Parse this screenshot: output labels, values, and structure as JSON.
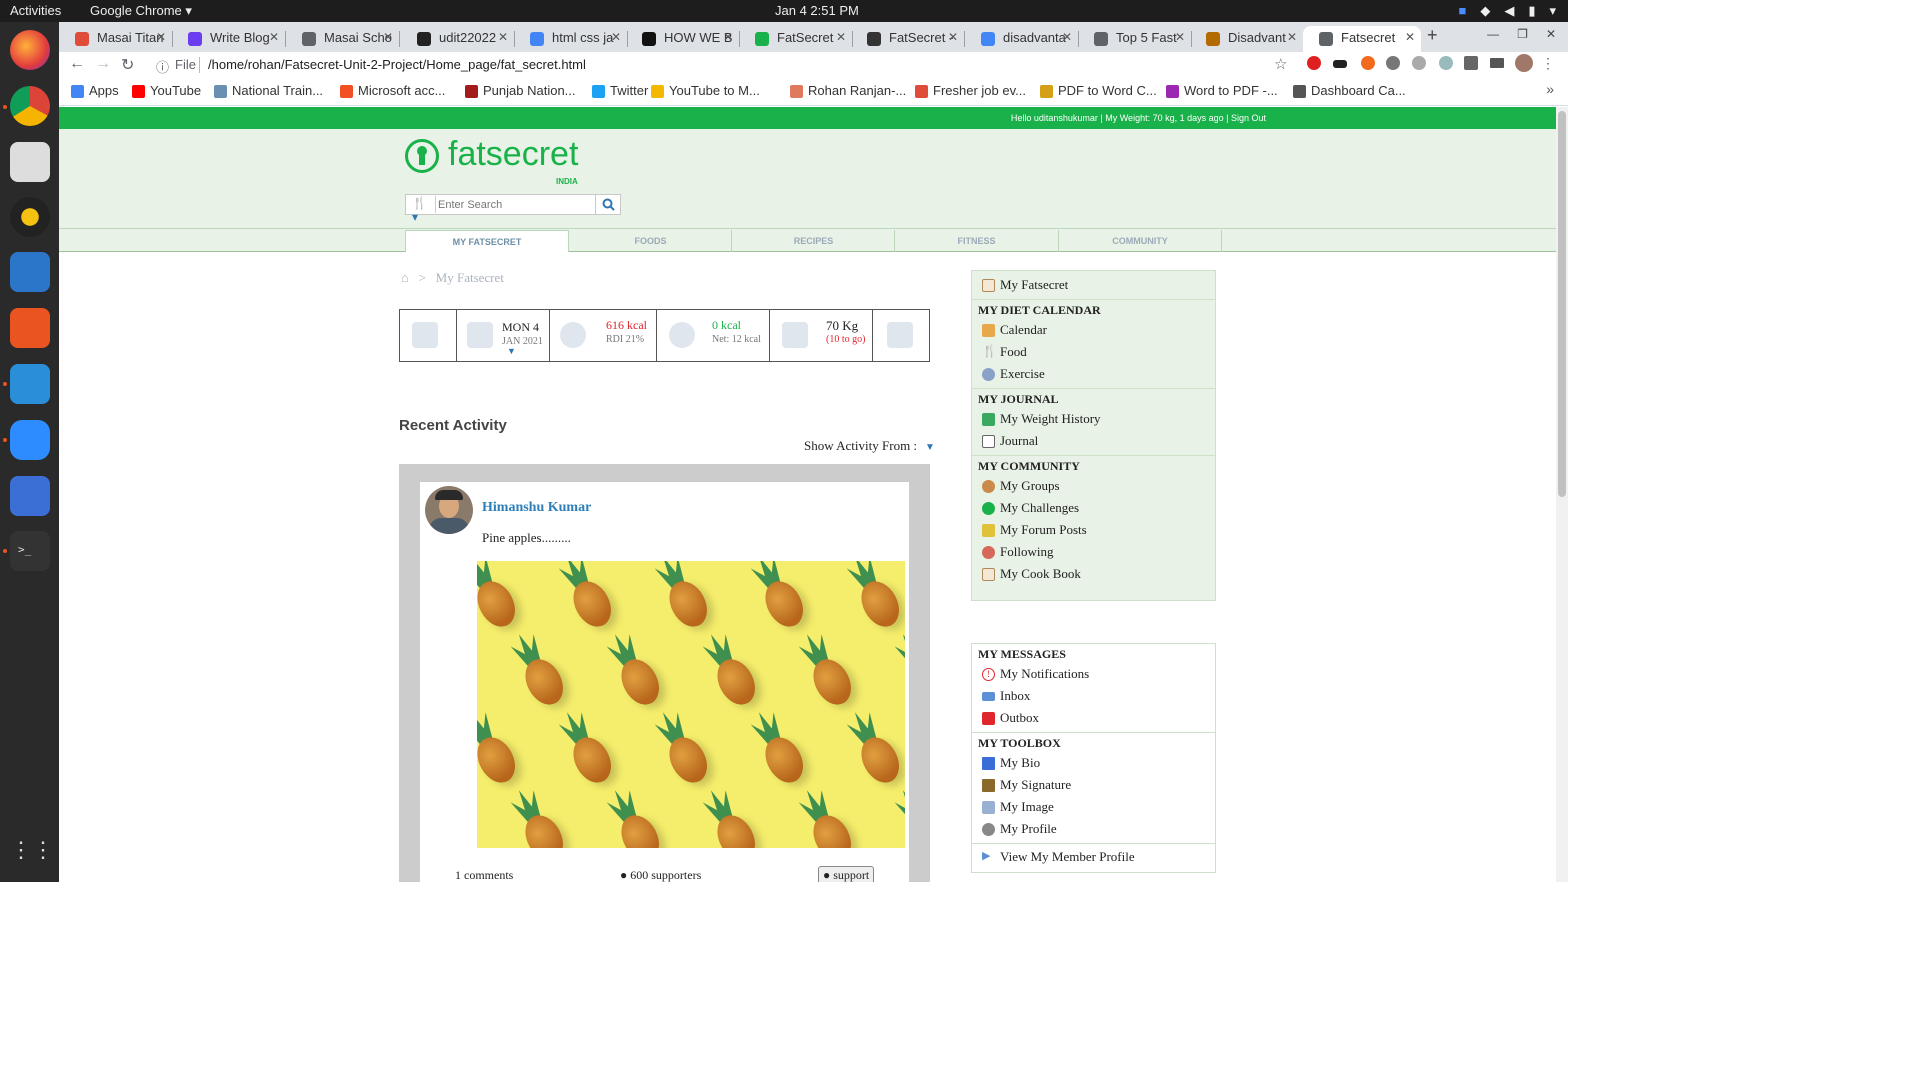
{
  "os": {
    "activities": "Activities",
    "app_name": "Google Chrome",
    "clock": "Jan 4   2:51 PM"
  },
  "browser": {
    "tabs": [
      {
        "label": "Masai Titan",
        "color": "#e04c3a"
      },
      {
        "label": "Write Blog",
        "color": "#6a3df0"
      },
      {
        "label": "Masai Scho",
        "color": "#5f6368"
      },
      {
        "label": "udit22022",
        "color": "#222222"
      },
      {
        "label": "html css ja",
        "color": "#4285f4"
      },
      {
        "label": "HOW WE B",
        "color": "#111111"
      },
      {
        "label": "FatSecret",
        "color": "#19b24a"
      },
      {
        "label": "FatSecret -",
        "color": "#333333"
      },
      {
        "label": "disadvanta",
        "color": "#4285f4"
      },
      {
        "label": "Top 5 Fast",
        "color": "#5f6368"
      },
      {
        "label": "Disadvant",
        "color": "#b36b00"
      },
      {
        "label": "Fatsecret",
        "color": "#5f6368"
      }
    ],
    "active_tab_index": 11,
    "new_tab": "+",
    "address_prefix": "File",
    "url": "/home/rohan/Fatsecret-Unit-2-Project/Home_page/fat_secret.html",
    "bookmarks": [
      {
        "label": "Apps",
        "color": "#4285f4"
      },
      {
        "label": "YouTube",
        "color": "#ff0000"
      },
      {
        "label": "National Train...",
        "color": "#6b8fb3"
      },
      {
        "label": "Microsoft acc...",
        "color": "#f25022"
      },
      {
        "label": "Punjab Nation...",
        "color": "#a31c1c"
      },
      {
        "label": "Twitter",
        "color": "#1da1f2"
      },
      {
        "label": "YouTube to M...",
        "color": "#f5b800"
      },
      {
        "label": "Rohan Ranjan-...",
        "color": "#e07a5f"
      },
      {
        "label": "Fresher job ev...",
        "color": "#e04c3a"
      },
      {
        "label": "PDF to Word C...",
        "color": "#d4a017"
      },
      {
        "label": "Word to PDF -...",
        "color": "#9c27b0"
      },
      {
        "label": "Dashboard Ca...",
        "color": "#555555"
      }
    ],
    "bookmarks_more": "»"
  },
  "site": {
    "greeting": "Hello uditanshukumar | My Weight: 70 kg, 1 days ago | Sign Out",
    "logo_word": "fatsecret",
    "logo_country": "INDIA",
    "search_placeholder": "Enter Search",
    "nav": [
      "MY FATSECRET",
      "FOODS",
      "RECIPES",
      "FITNESS",
      "COMMUNITY"
    ],
    "breadcrumb_sep": ">",
    "breadcrumb": "My Fatsecret",
    "summary": {
      "day": "MON 4",
      "month": "JAN 2021",
      "food_kcal": "616 kcal",
      "food_rdi": "RDI 21%",
      "exercise_kcal": "0 kcal",
      "exercise_net": "Net: 12 kcal",
      "weight": "70 Kg",
      "weight_goal": "(10 to go)"
    },
    "recent_activity_title": "Recent Activity",
    "show_activity_label": "Show Activity From :",
    "post": {
      "author": "Himanshu Kumar",
      "text": "Pine apples.........",
      "comments": "1 comments",
      "supporters": "600 supporters",
      "support_btn": "support"
    },
    "sidebar": {
      "top_item": "My Fatsecret",
      "diet_head": "MY DIET CALENDAR",
      "diet_items": [
        "Calendar",
        "Food",
        "Exercise"
      ],
      "journal_head": "MY JOURNAL",
      "journal_items": [
        "My Weight History",
        "Journal"
      ],
      "community_head": "MY COMMUNITY",
      "community_items": [
        "My Groups",
        "My Challenges",
        "My Forum Posts",
        "Following",
        "My Cook Book"
      ],
      "messages_head": "MY MESSAGES",
      "messages_items": [
        "My Notifications",
        "Inbox",
        "Outbox"
      ],
      "toolbox_head": "MY TOOLBOX",
      "toolbox_items": [
        "My Bio",
        "My Signature",
        "My Image",
        "My Profile"
      ],
      "member_profile": "View My Member Profile"
    }
  },
  "colors": {
    "brand_green": "#19b24a",
    "link_blue": "#2c7fb8",
    "alert_red": "#e0262d",
    "positive_green": "#19b24a"
  }
}
